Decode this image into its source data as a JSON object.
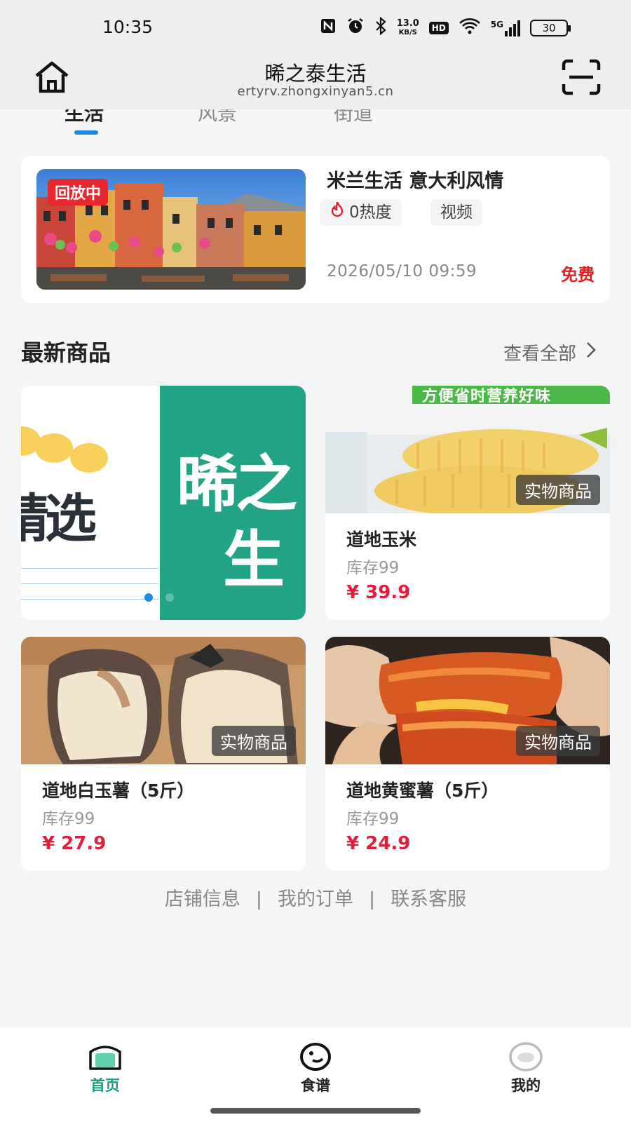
{
  "status_bar": {
    "time": "10:35",
    "speed_top": "13.0",
    "speed_bottom": "KB/S",
    "hd": "HD",
    "network": "5G",
    "battery": "30"
  },
  "header": {
    "title": "晞之泰生活",
    "url": "ertyrv.zhongxinyan5.cn"
  },
  "tabs": [
    "生活",
    "风景",
    "街道"
  ],
  "live": {
    "badge": "回放中",
    "title": "米兰生活 意大利风情",
    "heat": "0热度",
    "type": "视频",
    "datetime": "2026/05/10 09:59",
    "price": "免费"
  },
  "section": {
    "title": "最新商品",
    "more": "查看全部"
  },
  "banner": {
    "text1": "精选",
    "text2": "晞之",
    "text3": "生",
    "active_slide": 1,
    "slides": 2
  },
  "products": [
    {
      "name": "道地玉米",
      "stock": "库存99",
      "price": "¥ 39.9",
      "tag": "实物商品"
    },
    {
      "name": "道地白玉薯（5斤）",
      "stock": "库存99",
      "price": "¥ 27.9",
      "tag": "实物商品"
    },
    {
      "name": "道地黄蜜薯（5斤）",
      "stock": "库存99",
      "price": "¥ 24.9",
      "tag": "实物商品"
    }
  ],
  "corn_banner_text": "方便省时营养好味",
  "footer_links": [
    "店铺信息",
    "我的订单",
    "联系客服"
  ],
  "bottom_nav": [
    {
      "label": "首页",
      "active": true,
      "color": "#1a9b7f"
    },
    {
      "label": "食谱",
      "active": false,
      "color": "#222222"
    },
    {
      "label": "我的",
      "active": false,
      "color": "#222222"
    }
  ]
}
